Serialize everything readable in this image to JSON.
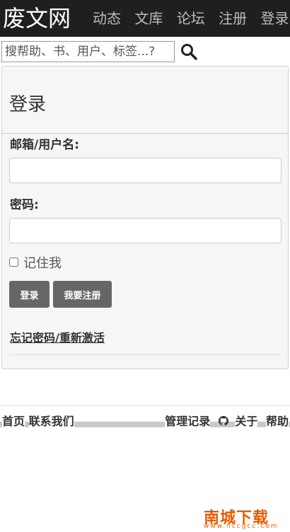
{
  "header": {
    "brand": "废文网",
    "nav": [
      "动态",
      "文库",
      "论坛",
      "注册",
      "登录"
    ]
  },
  "search": {
    "placeholder": "搜帮助、书、用户、标签...?"
  },
  "login": {
    "title": "登录",
    "email_label": "邮箱/用户名:",
    "email_value": "",
    "password_label": "密码:",
    "password_value": "",
    "remember_label": "记住我",
    "remember_checked": false,
    "login_button": "登录",
    "register_button": "我要注册",
    "forgot_link": "忘记密码/重新激活"
  },
  "footer": {
    "home": "首页",
    "contact": "联系我们",
    "admin_log": "管理记录",
    "about": "关于",
    "help": "帮助"
  },
  "watermark": {
    "main": "南城下载",
    "sub": "www.nccgcc.com"
  },
  "icons": {
    "search": "search-icon",
    "github": "github-icon"
  },
  "colors": {
    "header_bg": "#1f1f1f",
    "button_bg": "#666666",
    "panel_bg": "#f6f6f6",
    "watermark": "#e65c00"
  }
}
